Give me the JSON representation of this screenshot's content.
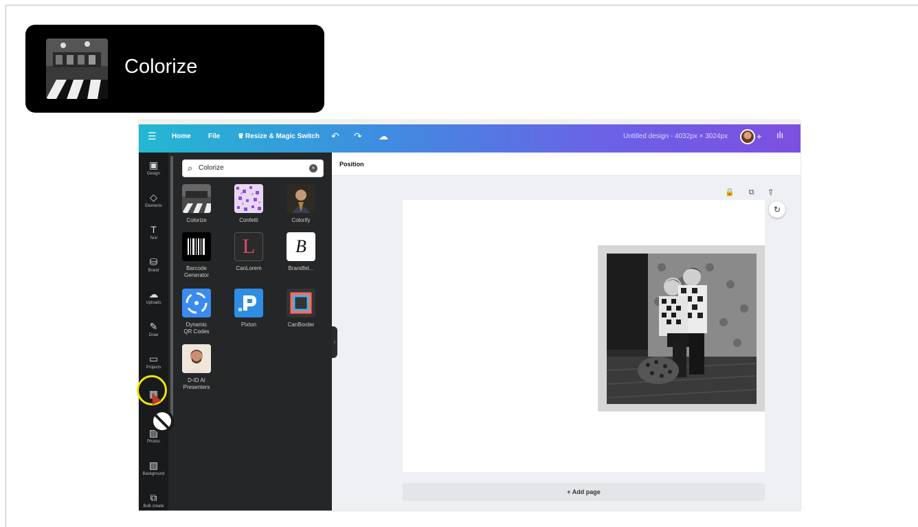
{
  "overlay": {
    "title": "Colorize"
  },
  "topbar": {
    "menu_icon": "☰",
    "home": "Home",
    "file": "File",
    "resize": "Resize & Magic Switch",
    "undo_icon": "↶",
    "redo_icon": "↷",
    "cloud_icon": "☁",
    "design_title": "Untitled design - 4032px × 3024px",
    "plus": "+",
    "chart_icon": "ılı"
  },
  "rail": [
    {
      "icon": "▣",
      "label": "Design"
    },
    {
      "icon": "◇",
      "label": "Elements"
    },
    {
      "icon": "T",
      "label": "Text"
    },
    {
      "icon": "⛁",
      "label": "Brand"
    },
    {
      "icon": "☁",
      "label": "Uploads"
    },
    {
      "icon": "✎",
      "label": "Draw"
    },
    {
      "icon": "▭",
      "label": "Projects"
    },
    {
      "icon": "▦",
      "label": ""
    },
    {
      "icon": "▨",
      "label": "Photos"
    },
    {
      "icon": "▧",
      "label": "Background"
    },
    {
      "icon": "⧉",
      "label": "Bulk create"
    }
  ],
  "search": {
    "value": "Colorize",
    "clear": "×",
    "icon": "⌕"
  },
  "apps": [
    {
      "label": "Colorize"
    },
    {
      "label": "Confetti"
    },
    {
      "label": "Colorify"
    },
    {
      "label": "Barcode\nGenerator"
    },
    {
      "label": "CanLorem"
    },
    {
      "label": "Brandfet..."
    },
    {
      "label": "Dynamic\nQR Codes"
    },
    {
      "label": "Pixton"
    },
    {
      "label": "CanBorder"
    },
    {
      "label": "D-ID AI\nPresenters"
    }
  ],
  "context": {
    "position": "Position"
  },
  "canvas": {
    "add_page": "+ Add page",
    "page_tools": "🔒 ⧉ ⇪",
    "refresh_icon": "↻"
  },
  "app_glyphs": {
    "canlorem": "L",
    "brandfetch": "B"
  }
}
